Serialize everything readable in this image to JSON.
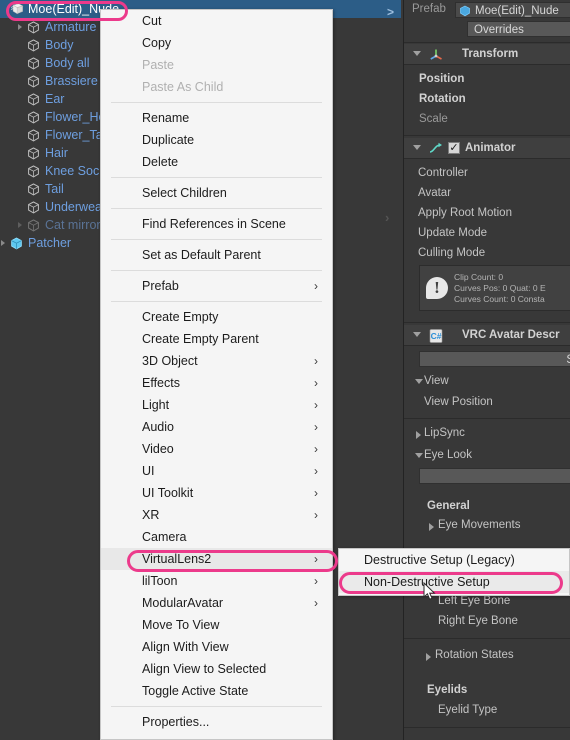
{
  "hierarchy": {
    "rows": [
      {
        "label": "Moe(Edit)_Nude",
        "indent": 1,
        "icon": "prefab-model-icon",
        "selected": true,
        "foldout": "none",
        "chevron": ">"
      },
      {
        "label": "Armature",
        "indent": 2,
        "icon": "gameobject-cube-icon",
        "selected": false,
        "foldout": "right"
      },
      {
        "label": "Body",
        "indent": 2,
        "icon": "gameobject-cube-icon",
        "selected": false,
        "foldout": "none"
      },
      {
        "label": "Body all",
        "indent": 2,
        "icon": "gameobject-cube-icon",
        "selected": false,
        "foldout": "none"
      },
      {
        "label": "Brassiere",
        "indent": 2,
        "icon": "gameobject-cube-icon",
        "selected": false,
        "foldout": "none"
      },
      {
        "label": "Ear",
        "indent": 2,
        "icon": "gameobject-cube-icon",
        "selected": false,
        "foldout": "none"
      },
      {
        "label": "Flower_He",
        "indent": 2,
        "icon": "gameobject-cube-icon",
        "selected": false,
        "foldout": "none"
      },
      {
        "label": "Flower_Ta",
        "indent": 2,
        "icon": "gameobject-cube-icon",
        "selected": false,
        "foldout": "none"
      },
      {
        "label": "Hair",
        "indent": 2,
        "icon": "gameobject-cube-icon",
        "selected": false,
        "foldout": "none"
      },
      {
        "label": "Knee Soc",
        "indent": 2,
        "icon": "gameobject-cube-icon",
        "selected": false,
        "foldout": "none"
      },
      {
        "label": "Tail",
        "indent": 2,
        "icon": "gameobject-cube-icon",
        "selected": false,
        "foldout": "none"
      },
      {
        "label": "Underwea",
        "indent": 2,
        "icon": "gameobject-cube-icon",
        "selected": false,
        "foldout": "none"
      },
      {
        "label": "Cat mirror",
        "indent": 2,
        "icon": "gameobject-cube-icon",
        "selected": false,
        "foldout": "right",
        "dim": true
      },
      {
        "label": "Patcher",
        "indent": 1,
        "icon": "prefab-cube-icon",
        "selected": false,
        "foldout": "right"
      }
    ]
  },
  "context_menu": {
    "items": [
      {
        "label": "Cut"
      },
      {
        "label": "Copy"
      },
      {
        "label": "Paste",
        "disabled": true
      },
      {
        "label": "Paste As Child",
        "disabled": true
      },
      {
        "separator": true
      },
      {
        "label": "Rename"
      },
      {
        "label": "Duplicate"
      },
      {
        "label": "Delete"
      },
      {
        "separator": true
      },
      {
        "label": "Select Children"
      },
      {
        "separator": true
      },
      {
        "label": "Find References in Scene"
      },
      {
        "separator": true
      },
      {
        "label": "Set as Default Parent"
      },
      {
        "separator": true
      },
      {
        "label": "Prefab",
        "submenu": true
      },
      {
        "separator": true
      },
      {
        "label": "Create Empty"
      },
      {
        "label": "Create Empty Parent"
      },
      {
        "label": "3D Object",
        "submenu": true
      },
      {
        "label": "Effects",
        "submenu": true
      },
      {
        "label": "Light",
        "submenu": true
      },
      {
        "label": "Audio",
        "submenu": true
      },
      {
        "label": "Video",
        "submenu": true
      },
      {
        "label": "UI",
        "submenu": true
      },
      {
        "label": "UI Toolkit",
        "submenu": true
      },
      {
        "label": "XR",
        "submenu": true
      },
      {
        "label": "Camera"
      },
      {
        "label": "VirtualLens2",
        "submenu": true,
        "highlighted": true
      },
      {
        "label": "lilToon",
        "submenu": true
      },
      {
        "label": "ModularAvatar",
        "submenu": true
      },
      {
        "label": "Move To View"
      },
      {
        "label": "Align With View"
      },
      {
        "label": "Align View to Selected"
      },
      {
        "label": "Toggle Active State"
      },
      {
        "separator": true
      },
      {
        "label": "Properties..."
      }
    ],
    "submenu_arrow": "›"
  },
  "submenu": {
    "items": [
      {
        "label": "Destructive Setup (Legacy)",
        "highlighted": false
      },
      {
        "label": "Non-Destructive Setup",
        "highlighted": true
      }
    ]
  },
  "inspector": {
    "prefab_label": "Prefab",
    "prefab_value": "Moe(Edit)_Nude",
    "overrides_button": "Overrides",
    "transform": {
      "title": "Transform",
      "position": "Position",
      "rotation": "Rotation",
      "scale": "Scale"
    },
    "animator": {
      "title": "Animator",
      "controller": "Controller",
      "avatar": "Avatar",
      "apply_root_motion": "Apply Root Motion",
      "update_mode": "Update Mode",
      "culling_mode": "Culling Mode",
      "help_line1": "Clip Count: 0",
      "help_line2": "Curves Pos: 0 Quat: 0 E",
      "help_line3": "Curves Count: 0 Consta",
      "warn_glyph": "!"
    },
    "vrc_avatar_descriptor": {
      "title": "VRC Avatar Descr",
      "top_button": "S",
      "view": "View",
      "view_position": "View Position",
      "lipsync": "LipSync",
      "eye_look": "Eye Look",
      "general": "General",
      "eye_movements": "Eye Movements",
      "left_eye_bone": "Left Eye Bone",
      "right_eye_bone": "Right Eye Bone",
      "rotation_states": "Rotation States",
      "eyelids": "Eyelids",
      "eyelid_type": "Eyelid Type"
    }
  },
  "annotations": {
    "accent_color": "#ec3a8b",
    "highlight_color": "#2c5d87",
    "boxes": [
      {
        "name": "selected-hierarchy-object"
      },
      {
        "name": "virtuallens2-menu-item"
      },
      {
        "name": "non-destructive-setup-item"
      }
    ]
  }
}
